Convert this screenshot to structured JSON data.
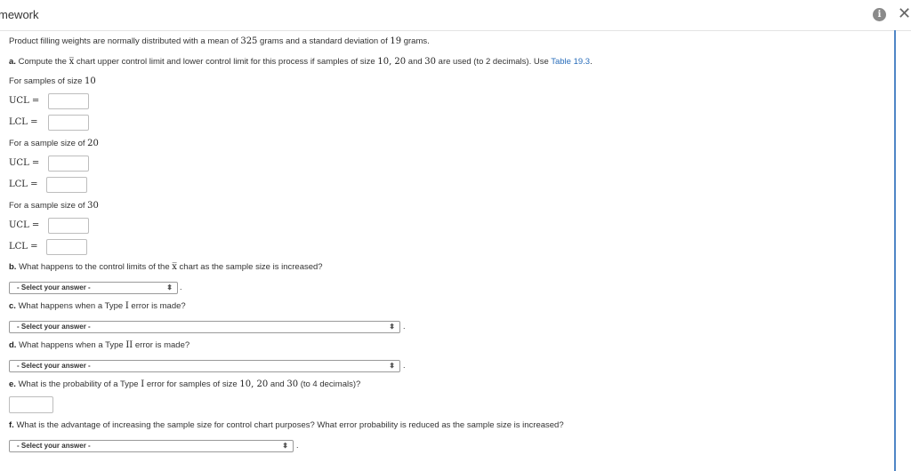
{
  "header": {
    "title": "mework"
  },
  "intro": {
    "pre": "Product filling weights are normally distributed with a mean of ",
    "mean": "325",
    "mid": " grams and a standard deviation of ",
    "sd": "19",
    "post": " grams."
  },
  "part_a": {
    "tag": "a.",
    "text1": " Compute the ",
    "xbar": "x̅",
    "text2": " chart upper control limit and lower control limit for this process if samples of size ",
    "n1": "10",
    "sep1": ", ",
    "n2": "20",
    "sep2": " and ",
    "n3": "30",
    "text3": " are used (to 2 decimals). Use ",
    "link": "Table 19.3",
    "end": ".",
    "groups": [
      {
        "heading": "For samples of size ",
        "size": "10",
        "ucl_label": "UCL =",
        "lcl_label": "LCL ="
      },
      {
        "heading": "For a sample size of ",
        "size": "20",
        "ucl_label": "UCL =",
        "lcl_label": "LCL ="
      },
      {
        "heading": "For a sample size of ",
        "size": "30",
        "ucl_label": "UCL =",
        "lcl_label": "LCL ="
      }
    ]
  },
  "part_b": {
    "tag": "b.",
    "text1": " What happens to the control limits of the ",
    "xbar": "x̅",
    "text2": " chart as the sample size is increased?",
    "select": "- Select your answer -"
  },
  "part_c": {
    "tag": "c.",
    "text1": " What happens when a Type ",
    "num": "I",
    "text2": " error is made?",
    "select": "- Select your answer -"
  },
  "part_d": {
    "tag": "d.",
    "text1": " What happens when a Type ",
    "num": "II",
    "text2": " error is made?",
    "select": "- Select your answer -"
  },
  "part_e": {
    "tag": "e.",
    "text1": " What is the probability of a Type ",
    "num": "I",
    "text2": " error for samples of size ",
    "n1": "10",
    "sep1": ", ",
    "n2": "20",
    "sep2": " and ",
    "n3": "30",
    "text3": " (to 4 decimals)?"
  },
  "part_f": {
    "tag": "f.",
    "text": " What is the advantage of increasing the sample size for control chart purposes? What error probability is reduced as the sample size is increased?",
    "select": "- Select your answer -"
  },
  "punct": {
    "period": "."
  },
  "icons": {
    "info": "info-icon",
    "close": "close-icon",
    "dropdown": "updown-arrow-icon"
  }
}
